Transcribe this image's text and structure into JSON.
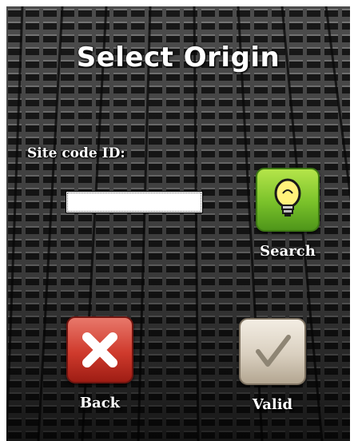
{
  "header": {
    "title": "Select Origin"
  },
  "form": {
    "site_code_label": "Site code ID:",
    "site_code_value": ""
  },
  "buttons": {
    "search": {
      "label": "Search",
      "icon": "lightbulb-icon",
      "color": "#79c12a"
    },
    "back": {
      "label": "Back",
      "icon": "close-icon",
      "color": "#cf3a2c"
    },
    "valid": {
      "label": "Valid",
      "icon": "checkmark-icon",
      "color": "#d9cfbf"
    }
  }
}
